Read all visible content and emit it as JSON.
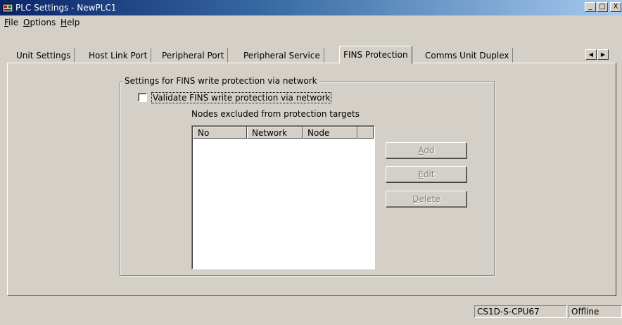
{
  "window": {
    "title": "PLC Settings - NewPLC1",
    "icon": "plc-app-icon"
  },
  "title_buttons": {
    "minimize": "_",
    "maximize": "□",
    "close": "X"
  },
  "menu": [
    {
      "label": "File",
      "mnemonic": "F",
      "rest": "ile"
    },
    {
      "label": "Options",
      "mnemonic": "O",
      "rest": "ptions"
    },
    {
      "label": "Help",
      "mnemonic": "H",
      "rest": "elp"
    }
  ],
  "tabs": [
    {
      "label": "Unit Settings"
    },
    {
      "label": "Host Link Port"
    },
    {
      "label": "Peripheral Port"
    },
    {
      "label": "Peripheral Service"
    },
    {
      "label": "FINS Protection",
      "active": true
    },
    {
      "label": "Comms Unit Duplex"
    }
  ],
  "tab_scroll": {
    "left": "◀",
    "right": "▶"
  },
  "fins": {
    "group_title": "Settings for FINS write protection via network",
    "checkbox_label": "Validate FINS write protection via network",
    "checkbox_checked": false,
    "nodes_label": "Nodes excluded from protection targets",
    "columns": [
      "No",
      "Network",
      "Node"
    ],
    "rows": []
  },
  "buttons": {
    "add": {
      "mnemonic": "A",
      "rest": "dd",
      "enabled": false
    },
    "edit": {
      "mnemonic": "E",
      "rest": "dit",
      "enabled": false
    },
    "delete": {
      "mnemonic": "D",
      "rest": "elete",
      "enabled": false
    }
  },
  "status": {
    "model": "CS1D-S-CPU67",
    "mode": "Offline"
  }
}
